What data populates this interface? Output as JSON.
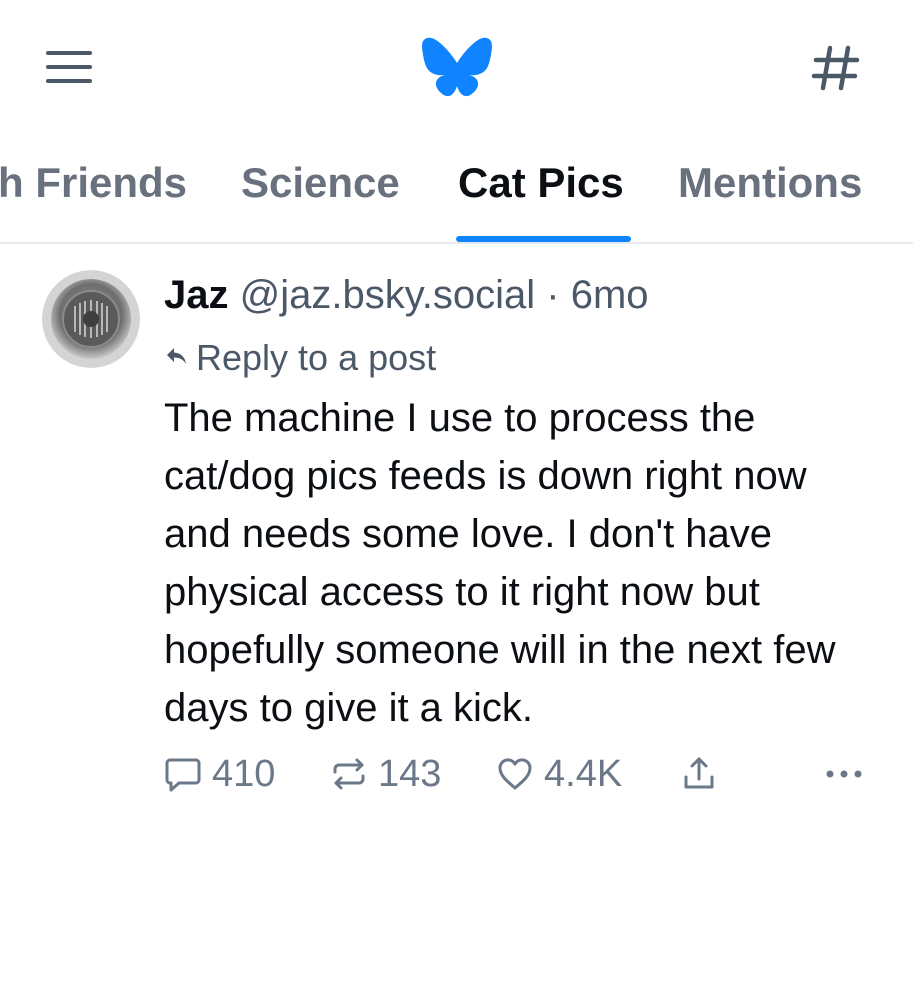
{
  "header": {
    "menu_icon": "hamburger-menu-icon",
    "logo_icon": "bluesky-butterfly-icon",
    "feeds_icon": "hashtag-icon",
    "accent_color": "#1083fe"
  },
  "tabs": [
    {
      "label": "h Friends"
    },
    {
      "label": "Science"
    },
    {
      "label": "Cat Pics",
      "active": true
    },
    {
      "label": "Mentions"
    }
  ],
  "post": {
    "author_name": "Jaz",
    "author_handle": "@jaz.bsky.social",
    "separator": "·",
    "time": "6mo",
    "reply_label": "Reply to a post",
    "text": "The machine I use to process the cat/dog pics feeds is down right now and needs some love. I don't have physical access to it right now but hopefully someone will in the next few days to give it a kick.",
    "stats": {
      "replies": "410",
      "reposts": "143",
      "likes": "4.4K"
    }
  }
}
